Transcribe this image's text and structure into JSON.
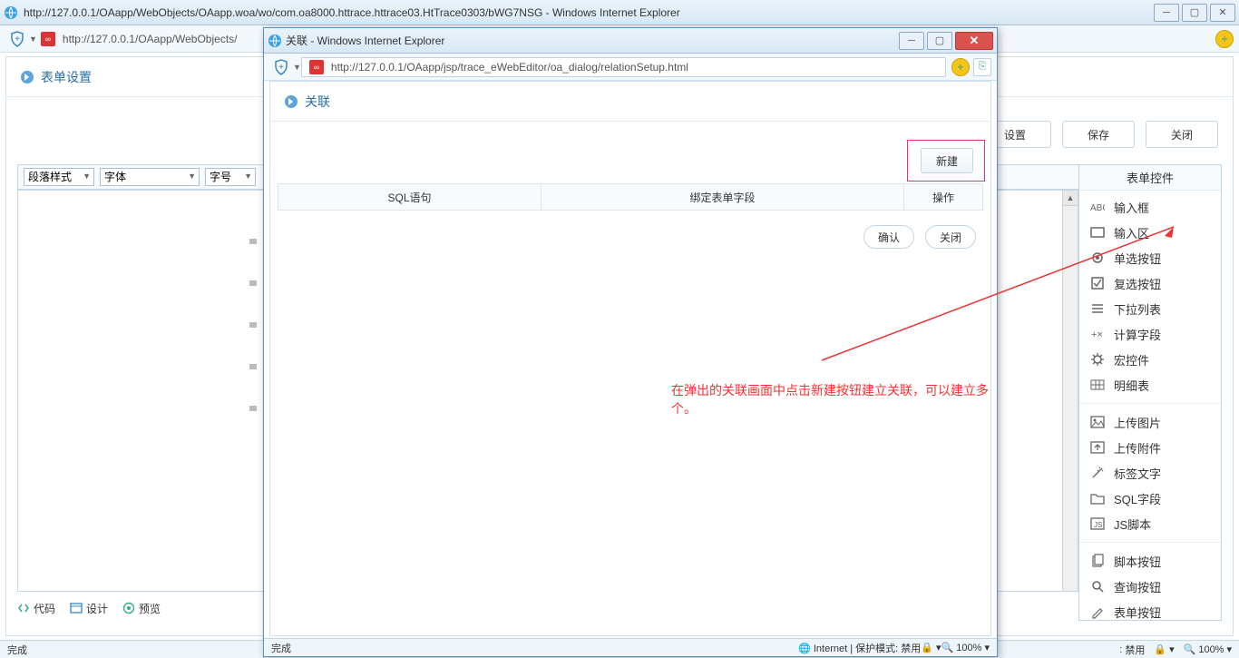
{
  "outer": {
    "title": "http://127.0.0.1/OAapp/WebObjects/OAapp.woa/wo/com.oa8000.httrace.httrace03.HtTrace0303/bWG7NSG - Windows Internet Explorer",
    "address": "http://127.0.0.1/OAapp/WebObjects/",
    "page_title": "表单设置",
    "buttons": {
      "set": "设置",
      "save": "保存",
      "close": "关闭"
    },
    "toolbar": {
      "para": "段落样式",
      "font": "字体",
      "size": "字号"
    },
    "bottom_tabs": {
      "code": "代码",
      "design": "设计",
      "preview": "预览"
    },
    "status": {
      "done": "完成",
      "mode": "禁用",
      "zoom": "100%"
    }
  },
  "sidebar": {
    "header": "表单控件",
    "items1": [
      {
        "icon": "abc",
        "label": "输入框"
      },
      {
        "icon": "rect",
        "label": "输入区"
      },
      {
        "icon": "radio",
        "label": "单选按钮"
      },
      {
        "icon": "check",
        "label": "复选按钮"
      },
      {
        "icon": "list",
        "label": "下拉列表"
      },
      {
        "icon": "calc",
        "label": "计算字段"
      },
      {
        "icon": "gear",
        "label": "宏控件"
      },
      {
        "icon": "grid",
        "label": "明细表"
      }
    ],
    "items2": [
      {
        "icon": "img",
        "label": "上传图片"
      },
      {
        "icon": "attach",
        "label": "上传附件"
      },
      {
        "icon": "wand",
        "label": "标签文字"
      },
      {
        "icon": "folder",
        "label": "SQL字段"
      },
      {
        "icon": "js",
        "label": "JS脚本"
      }
    ],
    "items3": [
      {
        "icon": "copy",
        "label": "脚本按钮"
      },
      {
        "icon": "search",
        "label": "查询按钮"
      },
      {
        "icon": "pen",
        "label": "表单按钮"
      }
    ]
  },
  "popup": {
    "title": "关联 - Windows Internet Explorer",
    "address": "http://127.0.0.1/OAapp/jsp/trace_eWebEditor/oa_dialog/relationSetup.html",
    "page_title": "关联",
    "new_btn": "新建",
    "th1": "SQL语句",
    "th2": "绑定表单字段",
    "th3": "操作",
    "confirm": "确认",
    "close": "关闭",
    "annotation": "在弹出的关联画面中点击新建按钮建立关联，可以建立多个。",
    "status": {
      "done": "完成",
      "internet": "Internet | 保护模式: 禁用",
      "zoom": "100%"
    }
  }
}
